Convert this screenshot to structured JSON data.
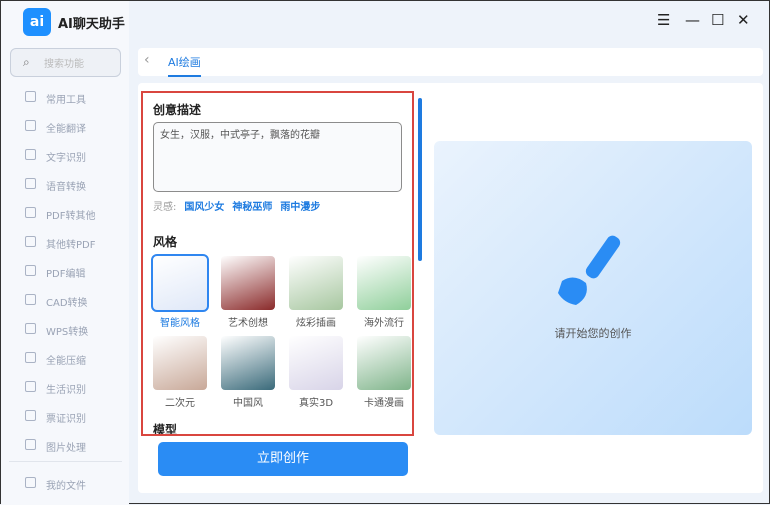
{
  "app": {
    "logo": "ai",
    "title": "AI聊天助手"
  },
  "sidebar": {
    "search_placeholder": "搜索功能",
    "items": [
      {
        "label": "常用工具",
        "icon": "grid-icon"
      },
      {
        "label": "全能翻译",
        "icon": "translate-icon"
      },
      {
        "label": "文字识别",
        "icon": "scan-text-icon"
      },
      {
        "label": "语音转换",
        "icon": "audio-icon"
      },
      {
        "label": "PDF转其他",
        "icon": "pdf-file-icon"
      },
      {
        "label": "其他转PDF",
        "icon": "file-convert-icon"
      },
      {
        "label": "PDF编辑",
        "icon": "pdf-edit-icon"
      },
      {
        "label": "CAD转换",
        "icon": "cad-icon"
      },
      {
        "label": "WPS转换",
        "icon": "wps-icon"
      },
      {
        "label": "全能压缩",
        "icon": "compress-icon"
      },
      {
        "label": "生活识别",
        "icon": "scan-icon"
      },
      {
        "label": "票证识别",
        "icon": "ticket-icon"
      },
      {
        "label": "图片处理",
        "icon": "image-icon"
      }
    ],
    "files": "我的文件"
  },
  "window": {
    "menu": "☰",
    "minimize": "—",
    "maximize": "☐",
    "close": "✕"
  },
  "tabs": {
    "back": "‹",
    "active": "AI绘画"
  },
  "form": {
    "desc_title": "创意描述",
    "desc_value": "女生，汉服，中式亭子，飘落的花瓣",
    "inspiration_label": "灵感:",
    "inspirations": [
      "国风少女",
      "神秘巫师",
      "雨中漫步"
    ],
    "style_title": "风格",
    "styles": [
      {
        "label": "智能风格",
        "selected": true,
        "color": "#dfe8f8"
      },
      {
        "label": "艺术创想",
        "color": "#8a2a2a"
      },
      {
        "label": "炫彩插画",
        "color": "#a7c7a0"
      },
      {
        "label": "海外流行",
        "color": "#8fcf9a"
      },
      {
        "label": "二次元",
        "color": "#c8a898"
      },
      {
        "label": "中国风",
        "color": "#3a6a7a"
      },
      {
        "label": "真实3D",
        "color": "#d8d4e8"
      },
      {
        "label": "卡通漫画",
        "color": "#7fb48a"
      }
    ],
    "model_title": "模型"
  },
  "preview": {
    "text": "请开始您的创作",
    "accent": "#2a8cf4"
  },
  "action": {
    "create": "立即创作"
  }
}
